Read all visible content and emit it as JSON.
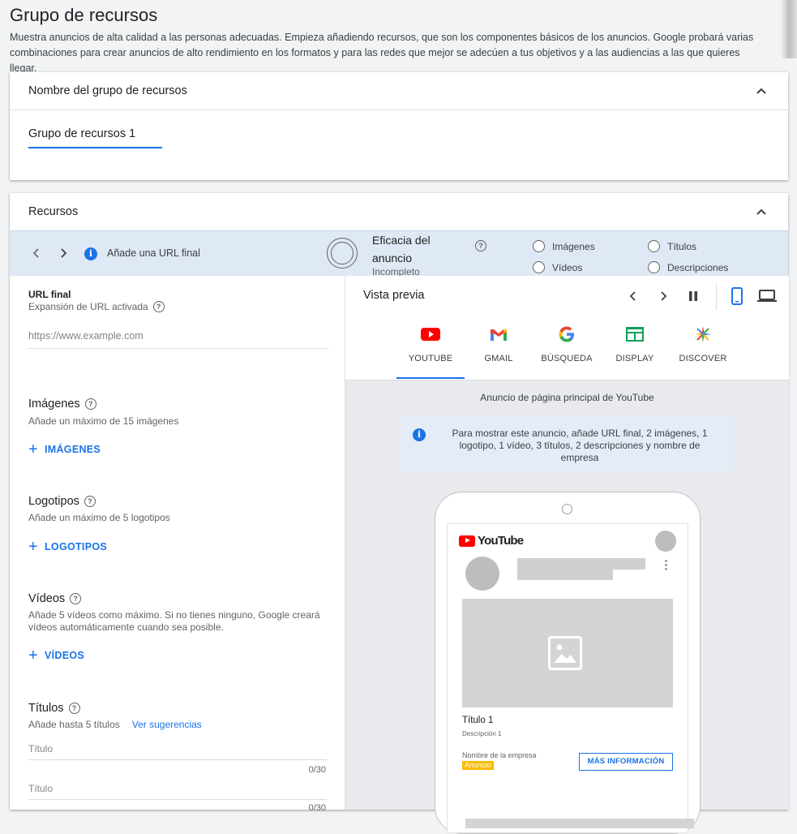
{
  "header": {
    "title": "Grupo de recursos",
    "description": "Muestra anuncios de alta calidad a las personas adecuadas. Empieza añadiendo recursos, que son los componentes básicos de los anuncios. Google probará varias combinaciones para crear anuncios de alto rendimiento en los formatos y para las redes que mejor se adecúen a tus objetivos y a las audiencias a las que quieres llegar."
  },
  "name_card": {
    "title": "Nombre del grupo de recursos",
    "value": "Grupo de recursos 1"
  },
  "resources_card": {
    "title": "Recursos",
    "status": {
      "message": "Añade una URL final",
      "effectiveness_title": "Eficacia del anuncio",
      "effectiveness_value": "Incompleto",
      "checks": [
        "Imágenes",
        "Vídeos",
        "Títulos",
        "Descripciones"
      ]
    }
  },
  "form": {
    "url_label": "URL final",
    "url_sub": "Expansión de URL activada",
    "url_placeholder": "https://www.example.com",
    "images_title": "Imágenes",
    "images_sub": "Añade un máximo de 15 imágenes",
    "images_btn": "IMÁGENES",
    "logos_title": "Logotipos",
    "logos_sub": "Añade un máximo de 5 logotipos",
    "logos_btn": "LOGOTIPOS",
    "videos_title": "Vídeos",
    "videos_sub": "Añade 5 vídeos como máximo. Si no tienes ninguno, Google creará vídeos automáticamente cuando sea posible.",
    "videos_btn": "VÍDEOS",
    "titles_title": "Títulos",
    "titles_sub": "Añade hasta 5 títulos",
    "titles_link": "Ver sugerencias",
    "title_placeholder_1": "Título",
    "title_counter_1": "0/30",
    "title_placeholder_2": "Título",
    "title_counter_2": "0/30"
  },
  "preview": {
    "title": "Vista previa",
    "tabs": [
      "YOUTUBE",
      "GMAIL",
      "BÚSQUEDA",
      "DISPLAY",
      "DISCOVER"
    ],
    "active_tab": "YOUTUBE",
    "caption": "Anuncio de página principal de YouTube",
    "info": "Para mostrar este anuncio, añade URL final, 2 imágenes, 1 logotipo, 1 vídeo, 3 títulos, 2 descripciones y nombre de empresa",
    "mock": {
      "logo_text": "YouTube",
      "ad_title": "Título 1",
      "ad_desc": "Descripción 1",
      "company": "Nombre de la empresa",
      "badge": "Anuncio",
      "cta": "MÁS INFORMACIÓN"
    }
  },
  "colors": {
    "accent": "#1a73e8",
    "status_bar": "#dfe9f5",
    "badge": "#fbbc04"
  }
}
